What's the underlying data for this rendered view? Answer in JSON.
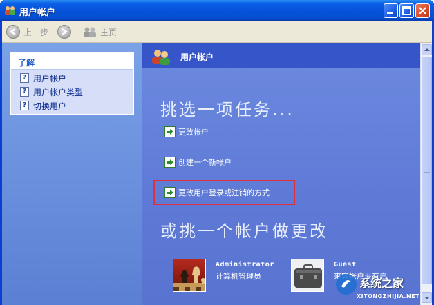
{
  "window": {
    "title": "用户帐户"
  },
  "toolbar": {
    "back_label": "上一步",
    "home_label": "主页"
  },
  "left_pane": {
    "learn_header": "了解",
    "items": [
      {
        "label": "用户帐户",
        "icon": "help-icon"
      },
      {
        "label": "用户帐户类型",
        "icon": "help-icon"
      },
      {
        "label": "切换用户",
        "icon": "help-icon"
      }
    ]
  },
  "main": {
    "header_title": "用户帐户",
    "pick_task": "挑选一项任务...",
    "tasks": [
      {
        "label": "更改帐户",
        "icon": "green-arrow-icon"
      },
      {
        "label": "创建一个新帐户",
        "icon": "green-arrow-icon"
      },
      {
        "label": "更改用户登录或注销的方式",
        "icon": "green-arrow-icon",
        "highlighted": true
      }
    ],
    "or_pick": "或挑一个帐户做更改",
    "accounts": [
      {
        "name": "Administrator",
        "role": "计算机管理员",
        "picture": "chess-picture"
      },
      {
        "name": "Guest",
        "role": "来宾帐户没有启",
        "picture": "briefcase-picture"
      }
    ]
  },
  "watermark": {
    "text": "系统之家",
    "sub": "XITONGZHIJIA.NET"
  },
  "colors": {
    "titlebar": "#0652d8",
    "left_pane": "#6e94e0",
    "right_pane": "#5e7ad6",
    "highlight_border": "#e0303c"
  }
}
